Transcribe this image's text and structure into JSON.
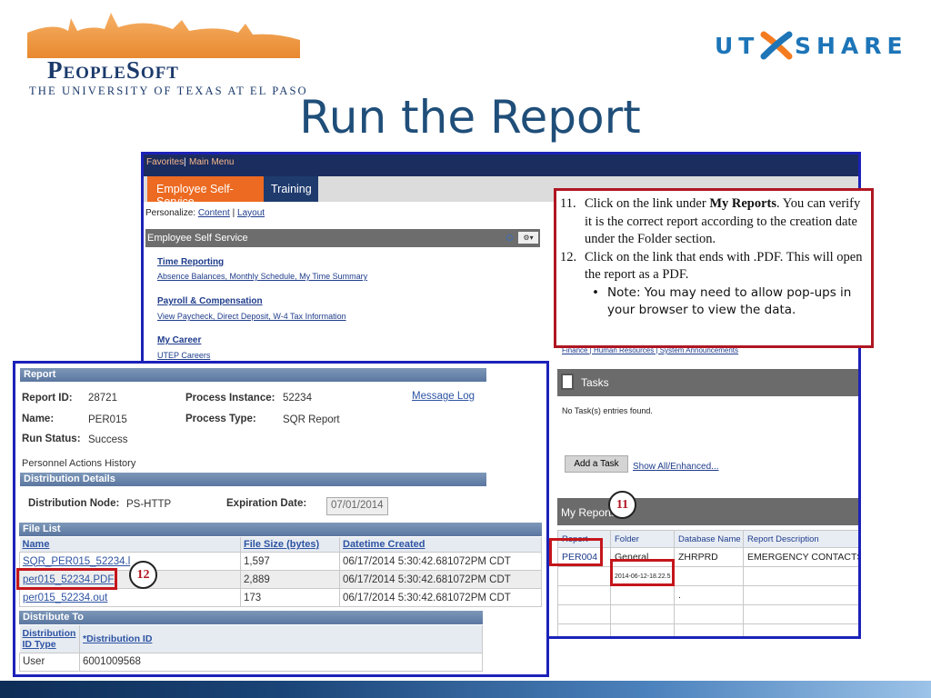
{
  "slide": {
    "title": "Run the Report",
    "peoplesoft_logo": {
      "word": "PeopleSoft",
      "subtitle": "THE UNIVERSITY OF TEXAS AT EL PASO"
    },
    "utshare_logo": {
      "left": "UT",
      "right": "SHARE"
    }
  },
  "portal": {
    "topbar": {
      "favorites": "Favorites",
      "main_menu": "Main Menu"
    },
    "tabs": [
      {
        "label": "Employee Self-Service"
      },
      {
        "label": "Training"
      }
    ],
    "personalize": {
      "label": "Personalize:",
      "content": "Content",
      "sep": "|",
      "layout": "Layout"
    },
    "ess_panel": {
      "title": "Employee Self Service",
      "sections": [
        {
          "heading": "Time Reporting",
          "links": "Absence Balances, Monthly Schedule, My Time Summary"
        },
        {
          "heading": "Payroll & Compensation",
          "links": "View Paycheck, Direct Deposit, W-4 Tax Information"
        },
        {
          "heading": "My Career",
          "links": "UTEP Careers"
        }
      ]
    },
    "right_links": "Finance | Human Resources | System Announcements",
    "tasks": {
      "title": "Tasks",
      "empty": "No Task(s) entries found.",
      "add_button": "Add a Task",
      "show_all": "Show All/Enhanced..."
    },
    "my_reports": {
      "title": "My Reports",
      "columns": [
        "Report",
        "Folder",
        "Database Name",
        "Report Description"
      ],
      "rows": [
        [
          "PER004",
          "General",
          "ZHRPRD",
          "EMERGENCY CONTACTS"
        ],
        [
          "",
          "2014-06-12-18.22.5",
          "",
          ""
        ],
        [
          "",
          "",
          ".",
          ""
        ],
        [
          "",
          "",
          "",
          ""
        ],
        [
          "",
          "",
          "",
          ""
        ]
      ]
    }
  },
  "callout": {
    "items": [
      {
        "num": "11.",
        "text_before": "Click on the link under ",
        "bold": "My Reports",
        "text_after": ". You can verify it is the correct report according to the creation date under the Folder section."
      },
      {
        "num": "12.",
        "text": "Click on the link that ends with .PDF. This will open the report as a PDF."
      }
    ],
    "note_bullet": "•",
    "note": "Note: You may need to allow pop-ups in your browser to view the data."
  },
  "report": {
    "section_title": "Report",
    "report_id_label": "Report ID:",
    "report_id": "28721",
    "process_instance_label": "Process Instance:",
    "process_instance": "52234",
    "message_log": "Message Log",
    "name_label": "Name:",
    "name": "PER015",
    "process_type_label": "Process Type:",
    "process_type": "SQR Report",
    "run_status_label": "Run Status:",
    "run_status": "Success",
    "description": "Personnel Actions History",
    "distribution_details": "Distribution Details",
    "dist_node_label": "Distribution Node:",
    "dist_node": "PS-HTTP",
    "exp_date_label": "Expiration Date:",
    "exp_date": "07/01/2014",
    "file_list": {
      "title": "File List",
      "columns": [
        "Name",
        "File Size (bytes)",
        "Datetime Created"
      ],
      "rows": [
        [
          "SQR_PER015_52234.l",
          "1,597",
          "06/17/2014  5:30:42.681072PM CDT"
        ],
        [
          "per015_52234.PDF",
          "2,889",
          "06/17/2014  5:30:42.681072PM CDT"
        ],
        [
          "per015_52234.out",
          "173",
          "06/17/2014  5:30:42.681072PM CDT"
        ]
      ]
    },
    "distribute_to": {
      "title": "Distribute To",
      "col1": "Distribution ID Type",
      "col2": "*Distribution ID",
      "row": [
        "User",
        "6001009568"
      ]
    }
  },
  "markers": {
    "step11": "11",
    "step12": "12"
  }
}
